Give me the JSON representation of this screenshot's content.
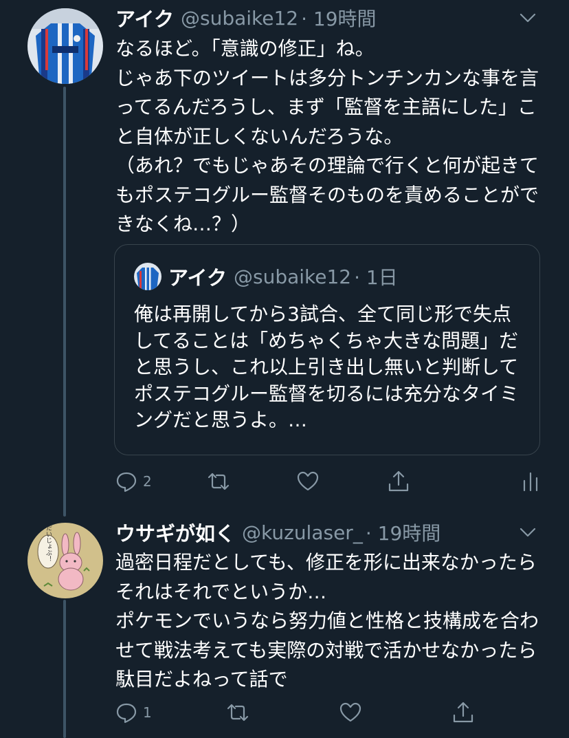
{
  "theme": {
    "background": "#15202b",
    "text_primary": "#ffffff",
    "text_secondary": "#8899a6",
    "thread_line": "#3d5466",
    "quote_border": "#38444d"
  },
  "tweets": [
    {
      "author": {
        "name": "アイク",
        "handle": "@subaike12",
        "time": "· 19時間",
        "avatar": "jersey-avatar"
      },
      "text": "なるほど。「意識の修正」ね。\nじゃあ下のツイートは多分トンチンカンな事を言ってるんだろうし、まず「監督を主語にした」こと自体が正しくないんだろうな。\n（あれ？でもじゃあその理論で行くと何が起きてもポステコグルー監督そのものを責めることができなくね…？）",
      "quoted": {
        "author": {
          "name": "アイク",
          "handle": "@subaike12",
          "time": "· 1日"
        },
        "text": "俺は再開してから3試合、全て同じ形で失点してることは「めちゃくちゃ大きな問題」だと思うし、これ以上引き出し無いと判断してポステコグルー監督を切るには充分なタイミングだと思うよ。…"
      },
      "actions": {
        "reply_count": "2",
        "retweet_icon": "retweet-icon",
        "like_icon": "heart-icon",
        "share_icon": "share-icon",
        "analytics_icon": "analytics-icon"
      }
    },
    {
      "author": {
        "name": "ウサギが如く",
        "handle": "@kuzulaser_",
        "time": "· 19時間",
        "avatar": "rabbit-avatar",
        "avatar_bubble_text": "だいじょぶ！"
      },
      "text": "過密日程だとしても、修正を形に出来なかったらそれはそれでというか…\nポケモンでいうなら努力値と性格と技構成を合わせて戦法考えても実際の対戦で活かせなかったら駄目だよねって話で",
      "actions": {
        "reply_count": "1",
        "retweet_icon": "retweet-icon",
        "like_icon": "heart-icon",
        "share_icon": "share-icon"
      }
    }
  ]
}
